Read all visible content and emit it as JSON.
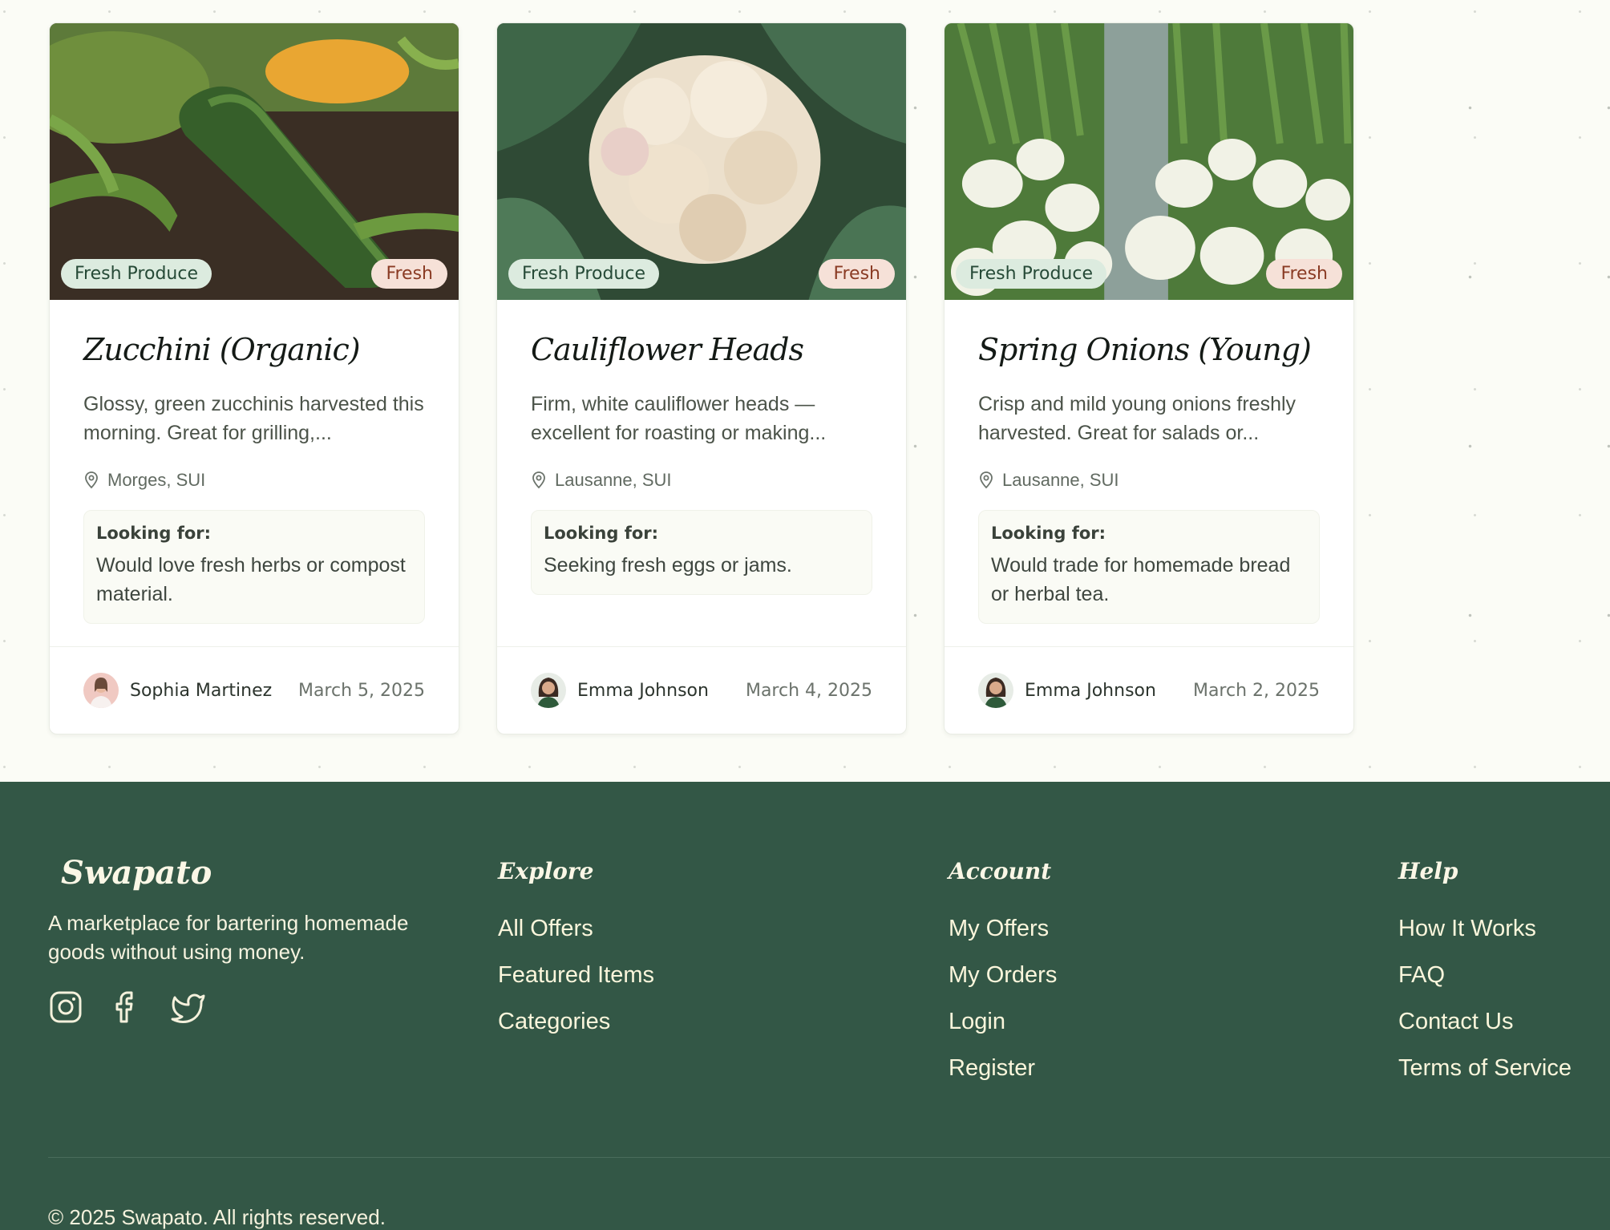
{
  "listings": [
    {
      "category": "Fresh Produce",
      "condition": "Fresh",
      "title": "Zucchini (Organic)",
      "description": "Glossy, green zucchinis harvested this morning. Great for grilling,...",
      "location": "Morges, SUI",
      "looking_for_label": "Looking for:",
      "looking_for": "Would love fresh herbs or compost material.",
      "author": "Sophia Martinez",
      "date": "March 5, 2025",
      "image_icon": "zucchini-photo"
    },
    {
      "category": "Fresh Produce",
      "condition": "Fresh",
      "title": "Cauliflower Heads",
      "description": "Firm, white cauliflower heads — excellent for roasting or making...",
      "location": "Lausanne, SUI",
      "looking_for_label": "Looking for:",
      "looking_for": "Seeking fresh eggs or jams.",
      "author": "Emma Johnson",
      "date": "March 4, 2025",
      "image_icon": "cauliflower-photo"
    },
    {
      "category": "Fresh Produce",
      "condition": "Fresh",
      "title": "Spring Onions (Young)",
      "description": "Crisp and mild young onions freshly harvested. Great for salads or...",
      "location": "Lausanne, SUI",
      "looking_for_label": "Looking for:",
      "looking_for": "Would trade for homemade bread or herbal tea.",
      "author": "Emma Johnson",
      "date": "March 2, 2025",
      "image_icon": "spring-onions-photo"
    }
  ],
  "footer": {
    "brand": "Swapato",
    "tagline": "A marketplace for bartering homemade goods without using money.",
    "socials": [
      "instagram-icon",
      "facebook-icon",
      "twitter-icon"
    ],
    "columns": [
      {
        "title": "Explore",
        "links": [
          "All Offers",
          "Featured Items",
          "Categories"
        ]
      },
      {
        "title": "Account",
        "links": [
          "My Offers",
          "My Orders",
          "Login",
          "Register"
        ]
      },
      {
        "title": "Help",
        "links": [
          "How It Works",
          "FAQ",
          "Contact Us",
          "Terms of Service"
        ]
      }
    ],
    "copyright": "© 2025 Swapato. All rights reserved."
  },
  "colors": {
    "footer_bg": "#335746",
    "category_tag_bg": "#dcebdf",
    "condition_tag_bg": "#f6e1d8",
    "page_bg": "#fbfcf6"
  }
}
